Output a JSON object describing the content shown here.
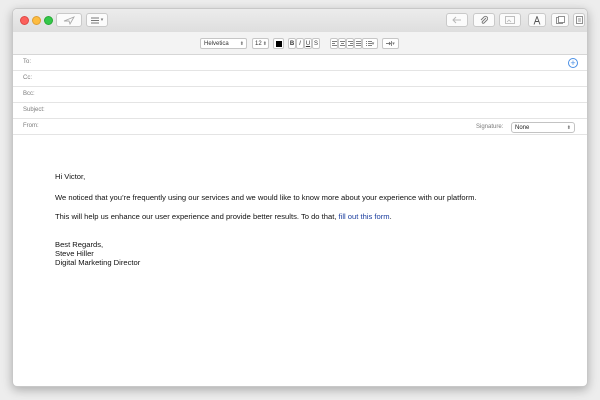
{
  "format_bar": {
    "font": "Helvetica",
    "size": "12",
    "bold": "B",
    "italic": "I",
    "underline": "U",
    "strike": "S"
  },
  "headers": {
    "to_label": "To:",
    "cc_label": "Cc:",
    "bcc_label": "Bcc:",
    "subject_label": "Subject:",
    "from_label": "From:",
    "signature_label": "Signature:",
    "signature_value": "None",
    "to_value": "",
    "cc_value": "",
    "bcc_value": "",
    "subject_value": ""
  },
  "message": {
    "greeting": "Hi Victor,",
    "paragraph1": "We noticed that you’re frequently using our services and we would like to know more about your experience with our platform.",
    "paragraph2_text": "This will help us enhance our user experience and provide better results. To do that, ",
    "paragraph2_link": "fill out this form",
    "paragraph2_end": ".",
    "closing": "Best Regards,",
    "sender_name": "Steve Hiller",
    "sender_title": "Digital Marketing Director"
  },
  "colors": {
    "link": "#1a3d9e",
    "accent": "#4a8fe5"
  }
}
